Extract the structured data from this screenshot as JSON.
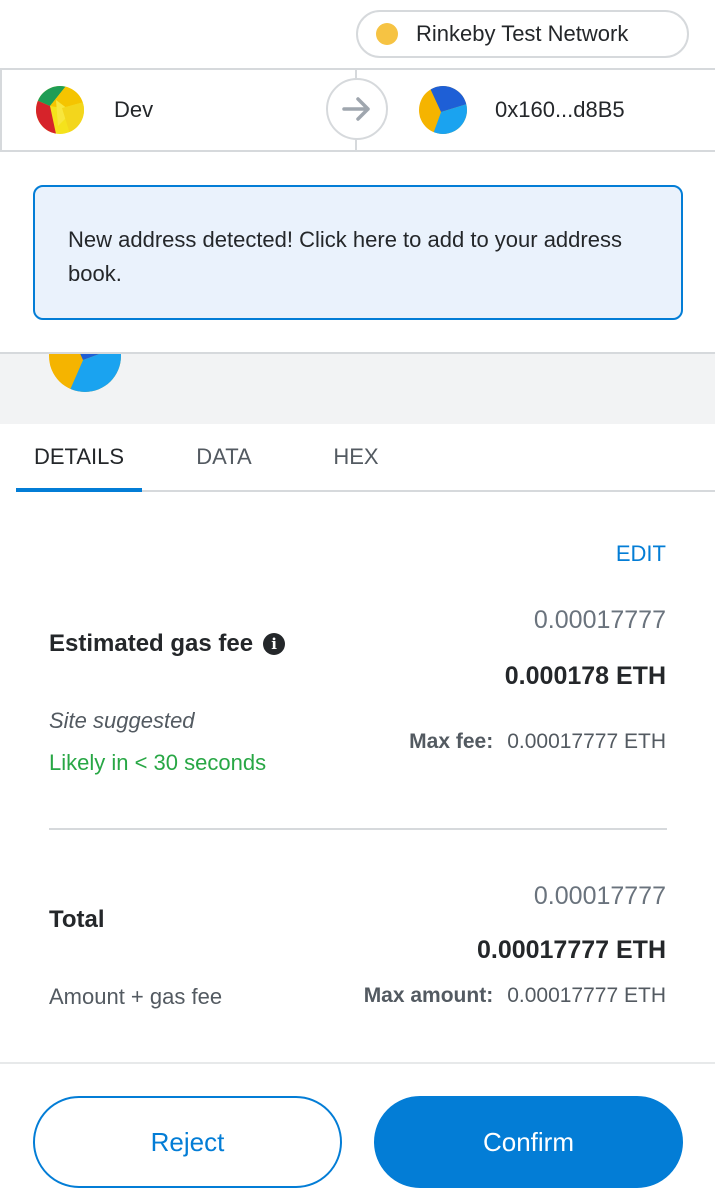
{
  "network": {
    "label": "Rinkeby Test Network",
    "dot_color": "#f6c343"
  },
  "sender": {
    "name": "Dev"
  },
  "recipient": {
    "address": "0x160...d8B5"
  },
  "notice": {
    "text": "New address detected! Click here to add to your address book."
  },
  "tabs": [
    {
      "label": "DETAILS",
      "active": true
    },
    {
      "label": "DATA",
      "active": false
    },
    {
      "label": "HEX",
      "active": false
    }
  ],
  "gas": {
    "edit_label": "EDIT",
    "label": "Estimated gas fee",
    "info_icon": "info-icon",
    "secondary_value": "0.00017777",
    "primary_value": "0.000178 ETH",
    "site_suggested": "Site suggested",
    "likely": "Likely in < 30 seconds",
    "max_fee_label": "Max fee:",
    "max_fee_value": "0.00017777 ETH"
  },
  "total": {
    "label": "Total",
    "secondary_value": "0.00017777",
    "primary_value": "0.00017777 ETH",
    "sub_label": "Amount + gas fee",
    "max_amount_label": "Max amount:",
    "max_amount_value": "0.00017777 ETH"
  },
  "buttons": {
    "reject": "Reject",
    "confirm": "Confirm"
  },
  "colors": {
    "accent": "#037dd6",
    "success": "#28a745",
    "notice_bg": "#eaf2fc"
  }
}
